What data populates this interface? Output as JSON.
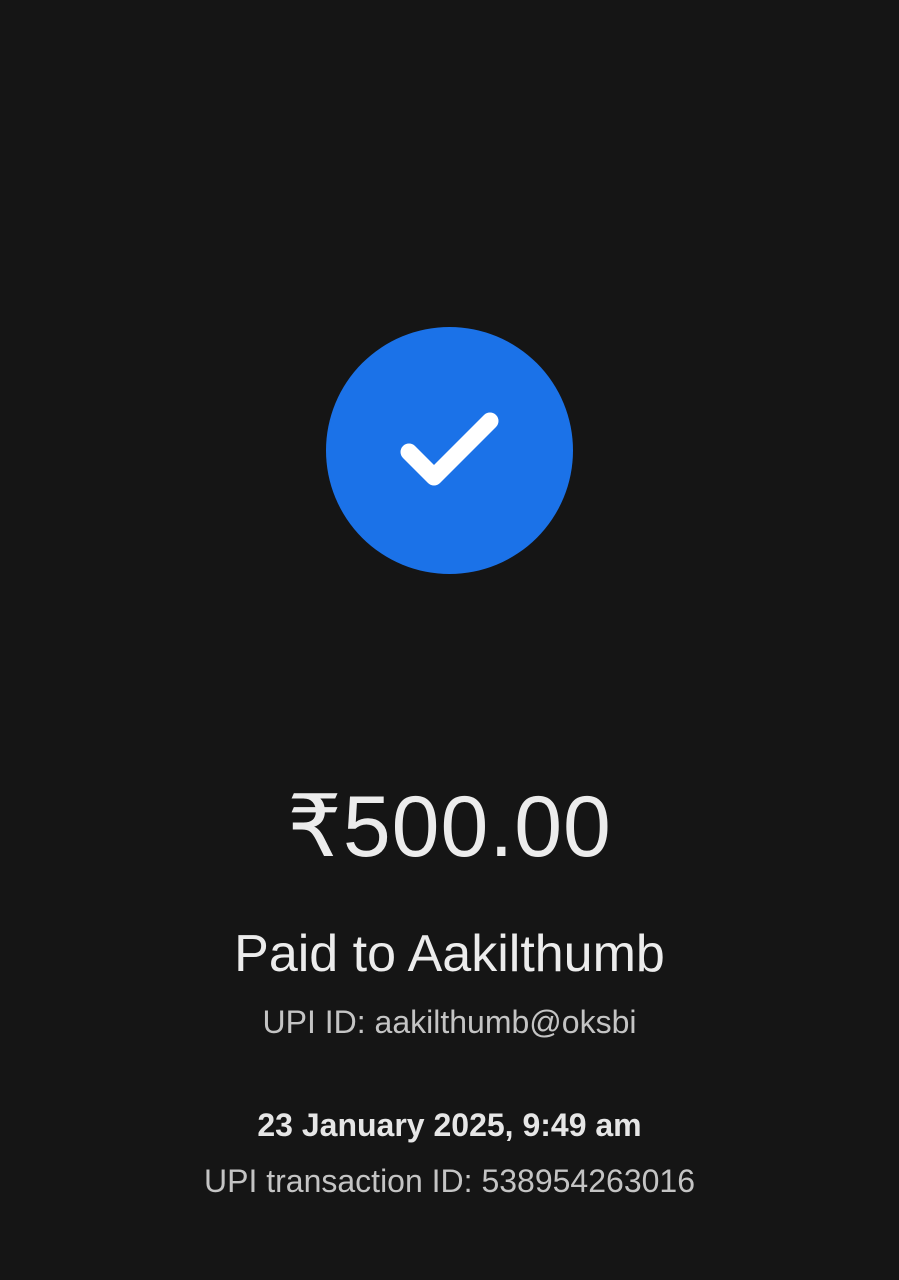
{
  "payment": {
    "status_icon": "check-icon",
    "accent_color": "#1b72e8",
    "amount": "₹500.00",
    "paid_to": "Paid to Aakilthumb",
    "upi_id": "UPI ID: aakilthumb@oksbi",
    "datetime": "23 January 2025, 9:49 am",
    "transaction_id": "UPI transaction ID: 538954263016"
  }
}
